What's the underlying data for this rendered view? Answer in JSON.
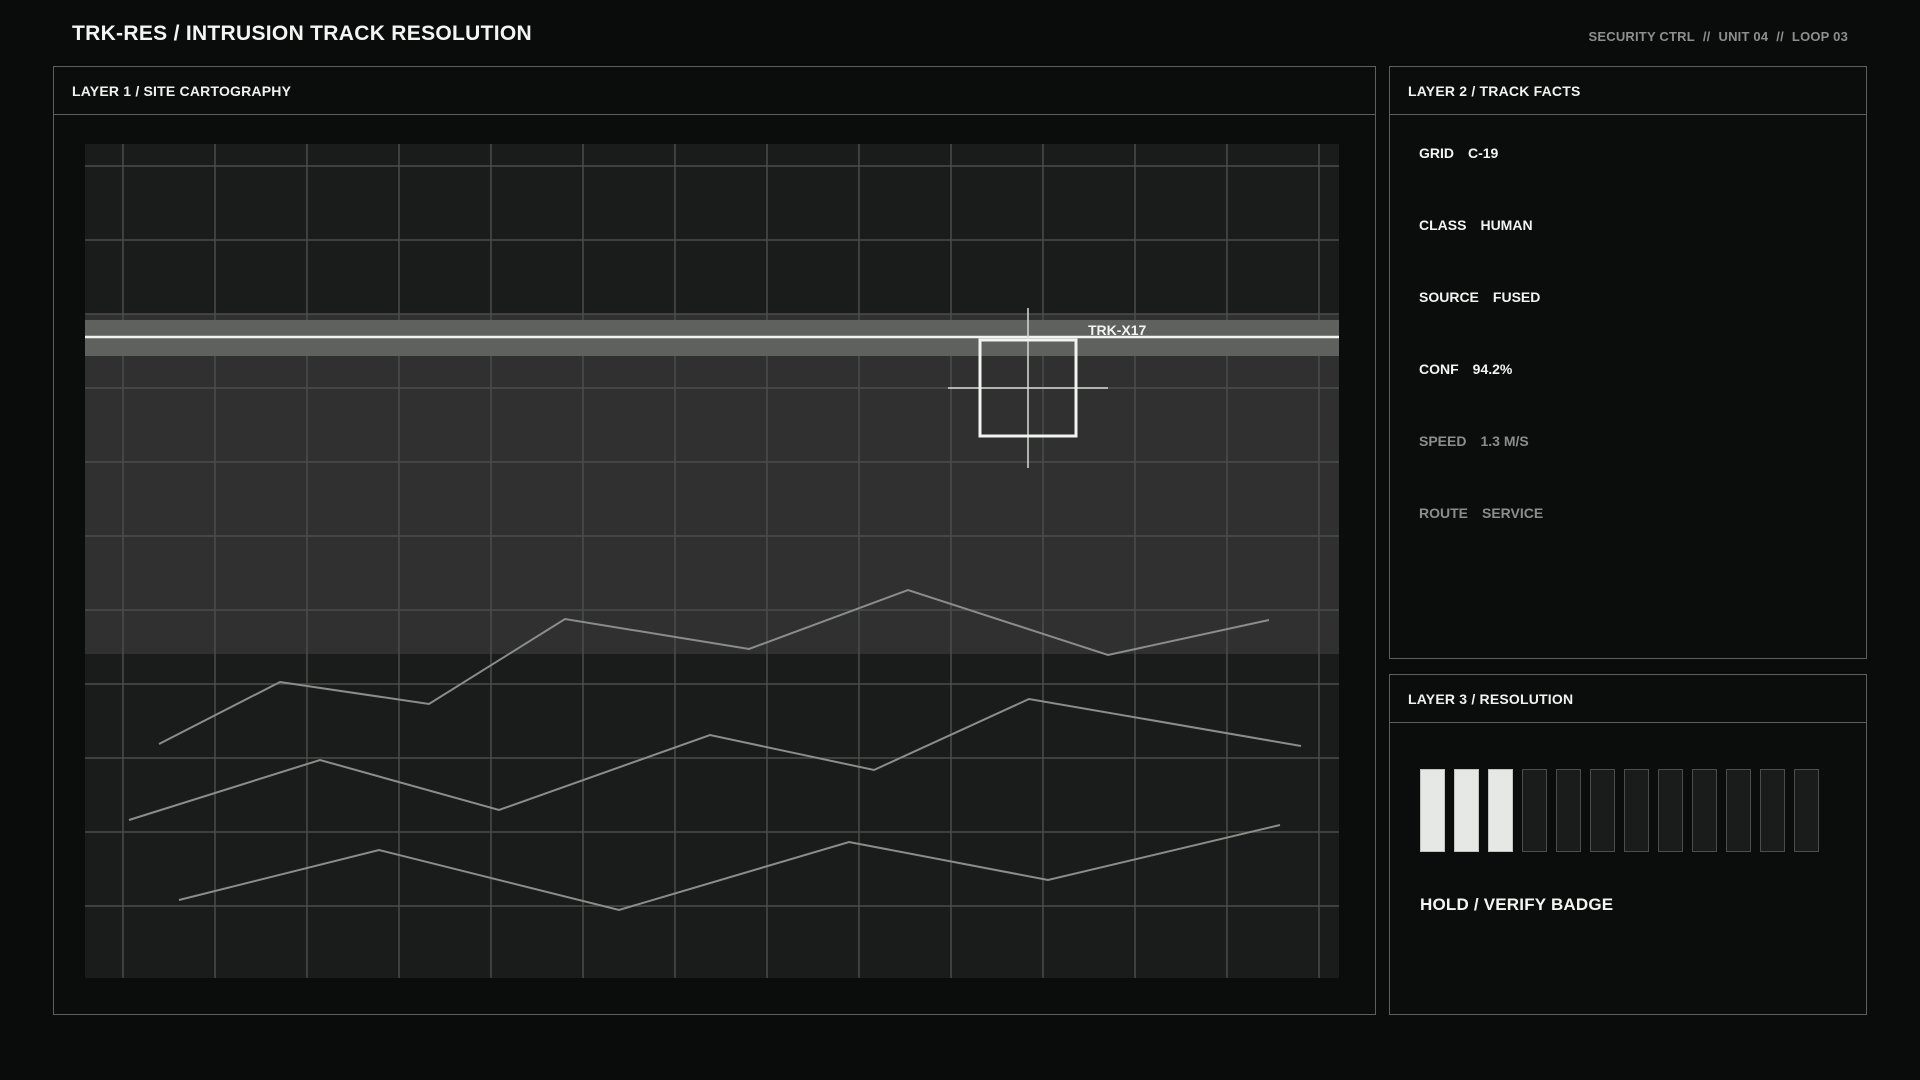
{
  "header": {
    "title": "TRK-RES / INTRUSION TRACK RESOLUTION",
    "status": [
      "SECURITY CTRL",
      "UNIT 04",
      "LOOP 03"
    ],
    "separator": "//"
  },
  "map_panel": {
    "title": "LAYER 1 / SITE CARTOGRAPHY",
    "track_label": "TRK-X17"
  },
  "facts_panel": {
    "title": "LAYER 2 / TRACK FACTS",
    "facts": [
      {
        "key": "GRID",
        "value": "C-19",
        "tone": "bright"
      },
      {
        "key": "CLASS",
        "value": "HUMAN",
        "tone": "bright"
      },
      {
        "key": "SOURCE",
        "value": "FUSED",
        "tone": "bright"
      },
      {
        "key": "CONF",
        "value": "94.2%",
        "tone": "bright"
      },
      {
        "key": "SPEED",
        "value": "1.3 M/S",
        "tone": "dim"
      },
      {
        "key": "ROUTE",
        "value": "SERVICE",
        "tone": "dim"
      }
    ]
  },
  "resolution_panel": {
    "title": "LAYER 3 / RESOLUTION",
    "meter": {
      "filled": 3,
      "total": 12
    },
    "status": "HOLD / VERIFY BADGE"
  },
  "colors": {
    "background": "#0a0c0b",
    "panel_border": "#5c605d",
    "accent": "#f3f5f3",
    "dim_text": "#8a8e8b",
    "highlight_band": "#5f615f"
  }
}
